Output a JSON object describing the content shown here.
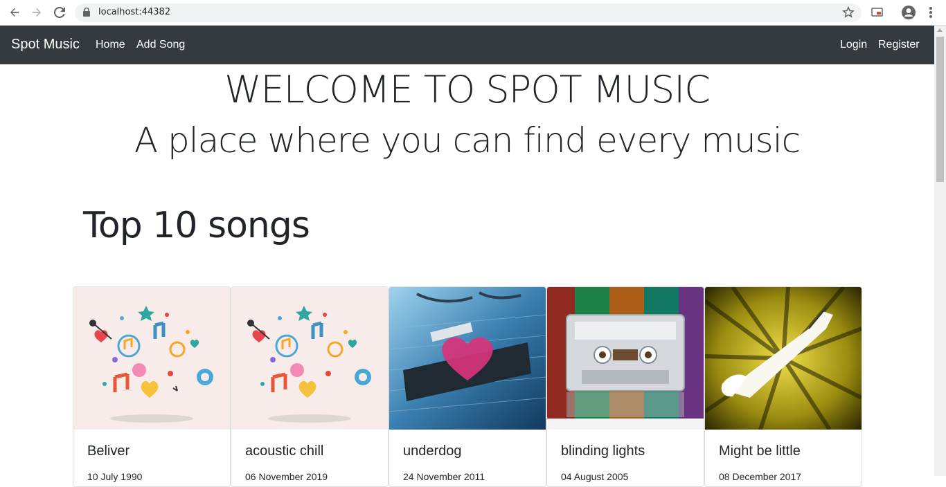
{
  "browser": {
    "url": "localhost:44382"
  },
  "navbar": {
    "brand": "Spot Music",
    "links": [
      "Home",
      "Add Song"
    ],
    "auth": [
      "Login",
      "Register"
    ]
  },
  "hero": {
    "title": "WELCOME TO SPOT MUSIC",
    "subtitle": "A place where you can find every music"
  },
  "section": {
    "title": "Top 10 songs"
  },
  "songs": [
    {
      "title": "Beliver",
      "date": "10 July 1990"
    },
    {
      "title": "acoustic chill",
      "date": "06 November 2019"
    },
    {
      "title": "underdog",
      "date": "24 November 2011"
    },
    {
      "title": "blinding lights",
      "date": "04 August 2005"
    },
    {
      "title": "Might be little",
      "date": "08 December 2017"
    }
  ],
  "colors": {
    "navbar": "#343a40",
    "text": "#212529"
  }
}
